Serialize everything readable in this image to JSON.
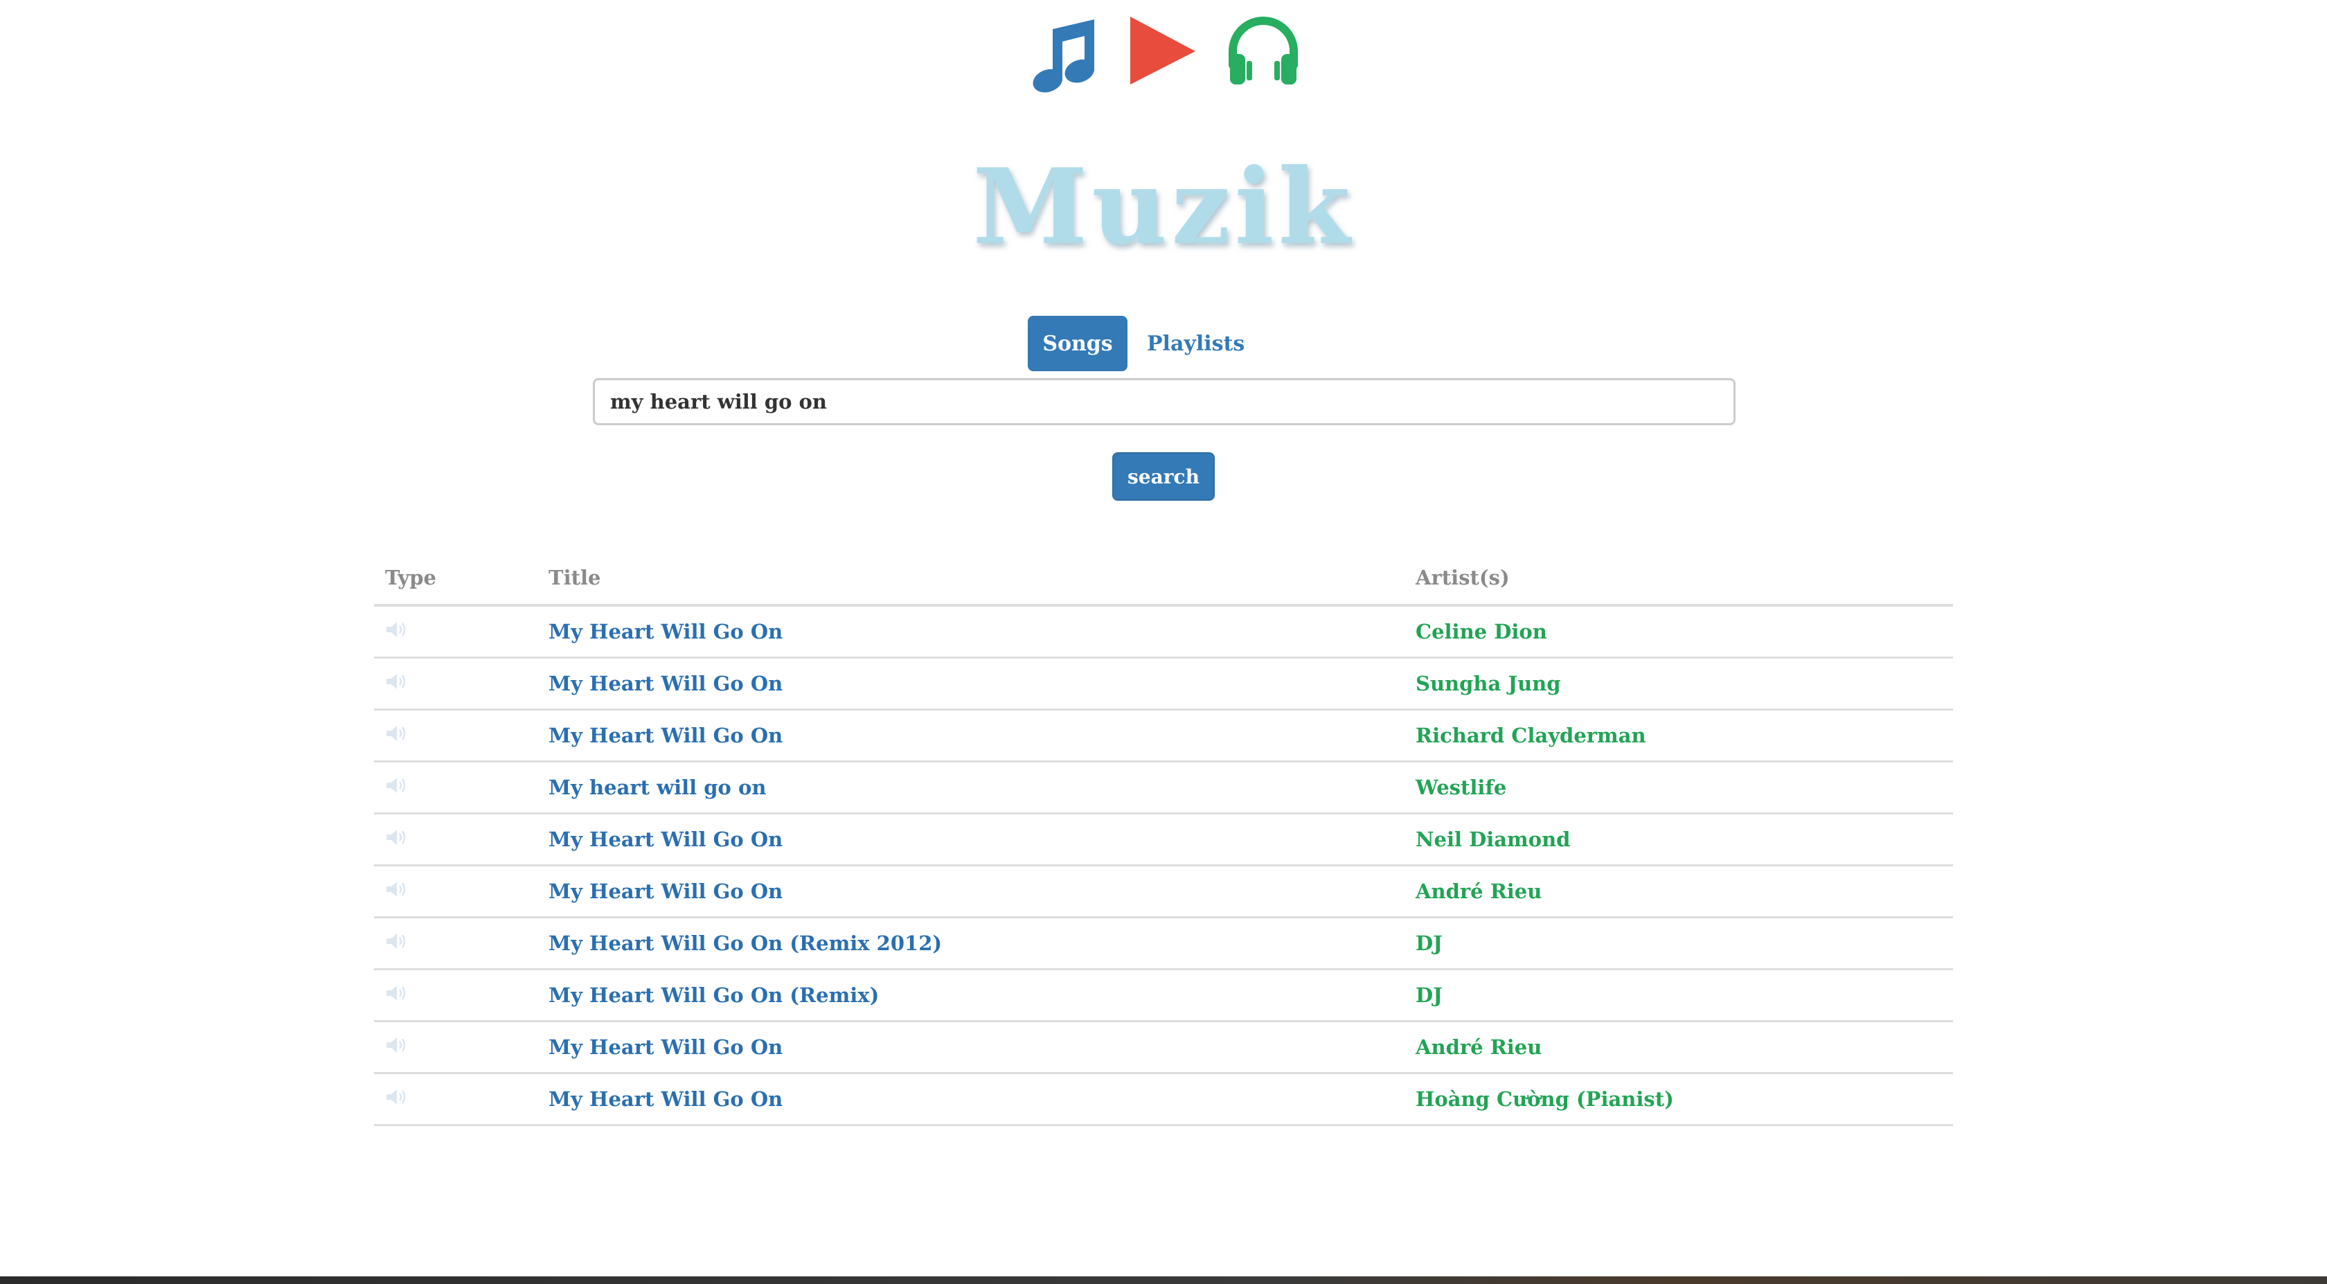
{
  "header": {
    "icons": [
      "music-note-icon",
      "play-icon",
      "headphones-icon"
    ],
    "logo_text": "Muzik"
  },
  "tabs": [
    {
      "label": "Songs",
      "active": true
    },
    {
      "label": "Playlists",
      "active": false
    }
  ],
  "search": {
    "value": "my heart will go on",
    "button_label": "search"
  },
  "results": {
    "columns": [
      "Type",
      "Title",
      "Artist(s)"
    ],
    "rows": [
      {
        "type_icon": "speaker-icon",
        "title": "My Heart Will Go On",
        "artist": "Celine Dion"
      },
      {
        "type_icon": "speaker-icon",
        "title": "My Heart Will Go On",
        "artist": "Sungha Jung"
      },
      {
        "type_icon": "speaker-icon",
        "title": "My Heart Will Go On",
        "artist": "Richard Clayderman"
      },
      {
        "type_icon": "speaker-icon",
        "title": "My heart will go on",
        "artist": "Westlife"
      },
      {
        "type_icon": "speaker-icon",
        "title": "My Heart Will Go On",
        "artist": "Neil Diamond"
      },
      {
        "type_icon": "speaker-icon",
        "title": "My Heart Will Go On",
        "artist": "André Rieu"
      },
      {
        "type_icon": "speaker-icon",
        "title": "My Heart Will Go On (Remix 2012)",
        "artist": "DJ"
      },
      {
        "type_icon": "speaker-icon",
        "title": "My Heart Will Go On (Remix)",
        "artist": "DJ"
      },
      {
        "type_icon": "speaker-icon",
        "title": "My Heart Will Go On",
        "artist": "André Rieu"
      },
      {
        "type_icon": "speaker-icon",
        "title": "My Heart Will Go On",
        "artist": "Hoàng Cường (Pianist)"
      }
    ]
  },
  "colors": {
    "primary": "#337ab7",
    "title_link": "#2a6fb0",
    "artist_link": "#22a455",
    "play_icon": "#e74c3c",
    "headphones_icon": "#27ae60",
    "logo": "#b0dcea",
    "header_text": "#8a8a8a"
  }
}
